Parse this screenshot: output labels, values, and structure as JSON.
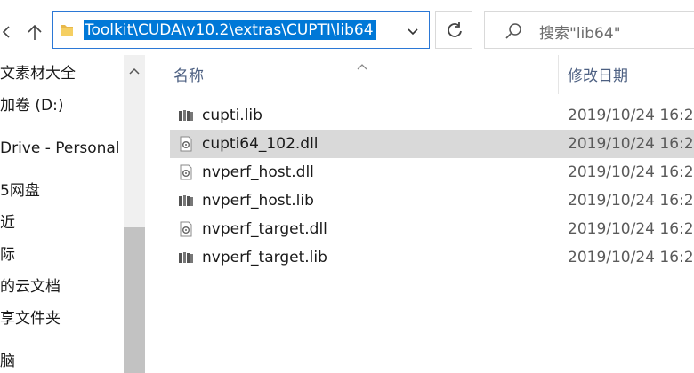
{
  "address_bar": {
    "path": "Toolkit\\CUDA\\v10.2\\extras\\CUPTI\\lib64"
  },
  "search": {
    "placeholder": "搜索\"lib64\""
  },
  "navigation_pane": {
    "items": [
      {
        "label": "文素材大全"
      },
      {
        "label": "加卷 (D:)"
      },
      {
        "label": "Drive - Personal"
      },
      {
        "label": "5网盘"
      },
      {
        "label": "近"
      },
      {
        "label": "际"
      },
      {
        "label": "的云文档"
      },
      {
        "label": "享文件夹"
      },
      {
        "label": "脑"
      }
    ]
  },
  "file_list": {
    "columns": {
      "name": "名称",
      "date": "修改日期"
    },
    "files": [
      {
        "name": "cupti.lib",
        "date": "2019/10/24 16:2",
        "type": "lib",
        "selected": false
      },
      {
        "name": "cupti64_102.dll",
        "date": "2019/10/24 16:2",
        "type": "dll",
        "selected": true
      },
      {
        "name": "nvperf_host.dll",
        "date": "2019/10/24 16:2",
        "type": "dll",
        "selected": false
      },
      {
        "name": "nvperf_host.lib",
        "date": "2019/10/24 16:2",
        "type": "lib",
        "selected": false
      },
      {
        "name": "nvperf_target.dll",
        "date": "2019/10/24 16:2",
        "type": "dll",
        "selected": false
      },
      {
        "name": "nvperf_target.lib",
        "date": "2019/10/24 16:2",
        "type": "lib",
        "selected": false
      }
    ]
  },
  "colors": {
    "selection_highlight": "#0078d7",
    "row_selected": "#d9d9d9",
    "header_text": "#4d6082",
    "address_border": "#2b78d6"
  },
  "icons": {
    "back": "chevron-left-icon",
    "up": "arrow-up-icon",
    "folder": "folder-icon",
    "dropdown": "chevron-down-icon",
    "refresh": "refresh-icon",
    "search": "search-icon",
    "lib_file": "library-file-icon",
    "dll_file": "dll-file-icon"
  }
}
